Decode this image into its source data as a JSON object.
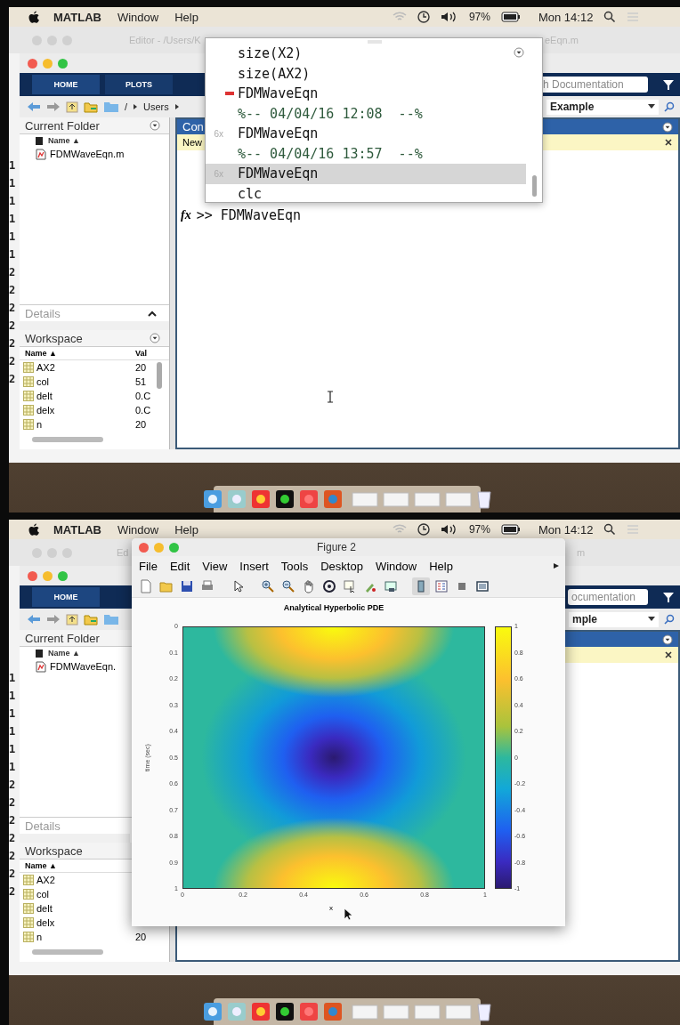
{
  "screens": [
    {
      "menubar": {
        "app": "MATLAB",
        "menus": [
          "Window",
          "Help"
        ],
        "battery": "97%",
        "clock": "Mon 14:12"
      },
      "editor_title": [
        "Editor - /Users/K",
        "eEqn.m"
      ],
      "gutter": [
        "1",
        "1",
        "1",
        "1",
        "1",
        "1",
        "2",
        "2",
        "2",
        "2",
        "2",
        "2",
        "2"
      ],
      "toolstrip": {
        "tabs": [
          {
            "label": "HOME",
            "selected": true
          },
          {
            "label": "PLOTS",
            "selected": false
          }
        ],
        "search": {
          "placeholder": "h Documentation"
        }
      },
      "address": {
        "path": [
          "/",
          "Users"
        ],
        "folder": "Example"
      },
      "current_folder": {
        "title": "Current Folder",
        "column": "Name ▲",
        "files": [
          "FDMWaveEqn.m"
        ]
      },
      "details": "Details",
      "workspace": {
        "title": "Workspace",
        "columns": [
          "Name ▲",
          "Val"
        ],
        "rows": [
          {
            "name": "AX2",
            "value": "20"
          },
          {
            "name": "col",
            "value": "51"
          },
          {
            "name": "delt",
            "value": "0.C"
          },
          {
            "name": "delx",
            "value": "0.C"
          },
          {
            "name": "n",
            "value": "20"
          }
        ]
      },
      "command_window": {
        "title": "Con",
        "notice": "New",
        "fx": "fx",
        "prompt": ">>",
        "command": "FDMWaveEqn"
      },
      "history_popup": {
        "items": [
          {
            "kind": "command",
            "text": "size(X2)",
            "selected": false
          },
          {
            "kind": "command",
            "text": "size(AX2)",
            "selected": false
          },
          {
            "kind": "error",
            "text": "FDMWaveEqn",
            "selected": false
          },
          {
            "kind": "session",
            "text": "%-- 04/04/16 12:08  --%",
            "selected": false
          },
          {
            "kind": "command",
            "count": "6x",
            "text": "FDMWaveEqn",
            "selected": false
          },
          {
            "kind": "session",
            "text": "%-- 04/04/16 13:57  --%",
            "selected": false
          },
          {
            "kind": "command",
            "count": "6x",
            "text": "FDMWaveEqn",
            "selected": true
          },
          {
            "kind": "command",
            "text": "clc",
            "selected": false
          }
        ]
      }
    },
    {
      "menubar": {
        "app": "MATLAB",
        "menus": [
          "Window",
          "Help"
        ],
        "battery": "97%",
        "clock": "Mon 14:12"
      },
      "editor_title": [
        "Ed",
        "m"
      ],
      "gutter": [
        "1",
        "1",
        "1",
        "1",
        "1",
        "1",
        "2",
        "2",
        "2",
        "2",
        "2",
        "2",
        "2"
      ],
      "toolstrip": {
        "tabs": [
          {
            "label": "HOME",
            "selected": true
          }
        ],
        "search": {
          "placeholder": "ocumentation"
        }
      },
      "address": {
        "folder": "mple"
      },
      "current_folder": {
        "title": "Current Folder",
        "column": "Name ▲",
        "files": [
          "FDMWaveEqn."
        ]
      },
      "details": "Details",
      "workspace": {
        "title": "Workspace",
        "columns": [
          "Name ▲"
        ],
        "rows": [
          {
            "name": "AX2"
          },
          {
            "name": "col"
          },
          {
            "name": "delt"
          },
          {
            "name": "delx"
          },
          {
            "name": "n",
            "value": "20"
          }
        ]
      },
      "figure": {
        "title": "Figure 2",
        "menus": [
          "File",
          "Edit",
          "View",
          "Insert",
          "Tools",
          "Desktop",
          "Window",
          "Help"
        ],
        "toolbar": [
          {
            "kind": "new",
            "on": false
          },
          {
            "kind": "open",
            "on": false
          },
          {
            "kind": "save",
            "on": false
          },
          {
            "kind": "print",
            "on": false
          },
          {
            "kind": "pointer",
            "on": false
          },
          {
            "kind": "zoomin",
            "on": false
          },
          {
            "kind": "zoomout",
            "on": false
          },
          {
            "kind": "pan",
            "on": false
          },
          {
            "kind": "rotate",
            "on": false
          },
          {
            "kind": "cursor",
            "on": false
          },
          {
            "kind": "brush",
            "on": false
          },
          {
            "kind": "link",
            "on": false
          },
          {
            "kind": "colorbar",
            "on": true
          },
          {
            "kind": "legend",
            "on": false
          },
          {
            "kind": "hide",
            "on": false
          },
          {
            "kind": "show",
            "on": false
          }
        ],
        "axes": {
          "title": "Analytical Hyperbolic PDE",
          "xlabel": "x",
          "ylabel": "time (sec)",
          "xticks": [
            "0",
            "0.2",
            "0.4",
            "0.6",
            "0.8",
            "1"
          ],
          "yticks": [
            "0",
            "0.1",
            "0.2",
            "0.3",
            "0.4",
            "0.5",
            "0.6",
            "0.7",
            "0.8",
            "0.9",
            "1"
          ]
        },
        "colorbar": {
          "ticks": [
            "1",
            "0.8",
            "0.6",
            "0.4",
            "0.2",
            "0",
            "-0.2",
            "-0.4",
            "-0.6",
            "-0.8",
            "-1"
          ]
        }
      }
    }
  ]
}
